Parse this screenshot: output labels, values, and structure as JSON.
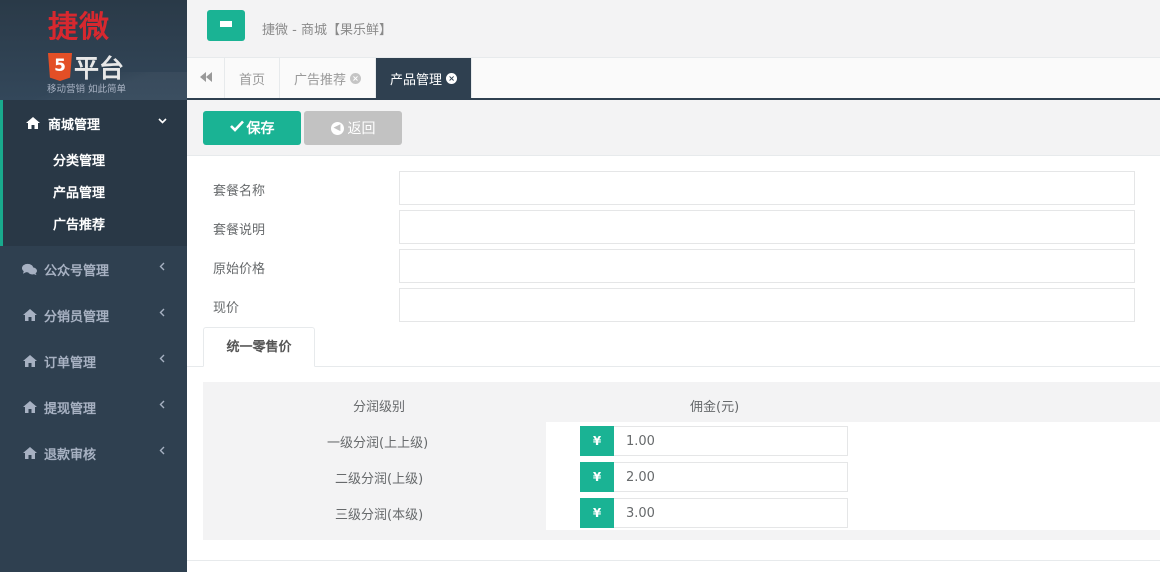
{
  "logo": {
    "title": "捷微",
    "shield": "5",
    "platform": "平台",
    "slogan": "移动营销 如此简单"
  },
  "sidebar": {
    "active": {
      "label": "商城管理",
      "icon": "home-icon",
      "children": [
        "分类管理",
        "产品管理",
        "广告推荐"
      ]
    },
    "items": [
      {
        "label": "公众号管理",
        "icon": "comments-icon"
      },
      {
        "label": "分销员管理",
        "icon": "home-icon"
      },
      {
        "label": "订单管理",
        "icon": "home-icon"
      },
      {
        "label": "提现管理",
        "icon": "home-icon"
      },
      {
        "label": "退款审核",
        "icon": "home-icon"
      }
    ]
  },
  "header": {
    "title": "捷微 - 商城【果乐鲜】"
  },
  "tabs": [
    {
      "label": "首页",
      "closable": false,
      "active": false
    },
    {
      "label": "广告推荐",
      "closable": true,
      "active": false
    },
    {
      "label": "产品管理",
      "closable": true,
      "active": true
    }
  ],
  "toolbar": {
    "save_label": "保存",
    "back_label": "返回"
  },
  "form": {
    "fields": [
      {
        "label": "套餐名称",
        "value": ""
      },
      {
        "label": "套餐说明",
        "value": ""
      },
      {
        "label": "原始价格",
        "value": ""
      },
      {
        "label": "现价",
        "value": ""
      }
    ]
  },
  "subtab": {
    "label": "统一零售价"
  },
  "commission": {
    "level_header": "分润级别",
    "amount_header": "佣金(元)",
    "currency_symbol": "¥",
    "rows": [
      {
        "level": "一级分润(上上级)",
        "amount": "1.00"
      },
      {
        "level": "二级分润(上级)",
        "amount": "2.00"
      },
      {
        "level": "三级分润(本级)",
        "amount": "3.00"
      }
    ]
  },
  "colors": {
    "accent": "#1ab394",
    "sidebar_bg": "#2f4050",
    "sidebar_active_bg": "#293846",
    "logo_red": "#d7282f",
    "html5_orange": "#e34f26",
    "back_button": "#c2c2c2"
  }
}
